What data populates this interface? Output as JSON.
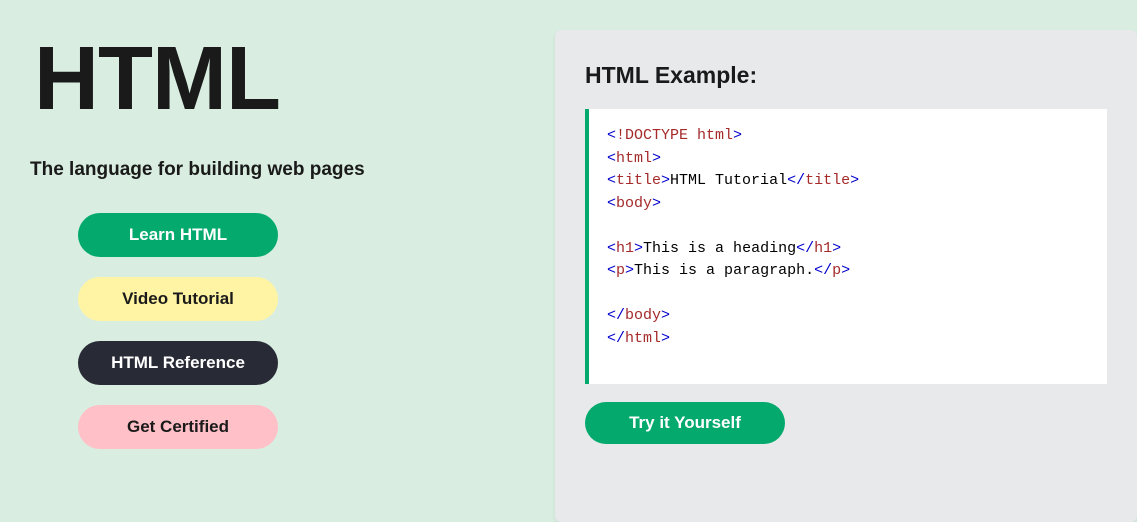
{
  "left": {
    "title": "HTML",
    "subtitle": "The language for building web pages",
    "buttons": {
      "learn": "Learn HTML",
      "video": "Video Tutorial",
      "reference": "HTML Reference",
      "certified": "Get Certified"
    }
  },
  "right": {
    "example_title": "HTML Example:",
    "try_label": "Try it Yourself",
    "code": {
      "line1_open": "<",
      "line1_tag": "!DOCTYPE",
      "line1_attr": " html",
      "line1_close": ">",
      "line2_open": "<",
      "line2_tag": "html",
      "line2_close": ">",
      "line3_open": "<",
      "line3_tag": "title",
      "line3_close": ">",
      "line3_text": "HTML Tutorial",
      "line3_end_open": "</",
      "line3_end_tag": "title",
      "line3_end_close": ">",
      "line4_open": "<",
      "line4_tag": "body",
      "line4_close": ">",
      "line5_open": "<",
      "line5_tag": "h1",
      "line5_close": ">",
      "line5_text": "This is a heading",
      "line5_end_open": "</",
      "line5_end_tag": "h1",
      "line5_end_close": ">",
      "line6_open": "<",
      "line6_tag": "p",
      "line6_close": ">",
      "line6_text": "This is a paragraph.",
      "line6_end_open": "</",
      "line6_end_tag": "p",
      "line6_end_close": ">",
      "line7_open": "</",
      "line7_tag": "body",
      "line7_close": ">",
      "line8_open": "</",
      "line8_tag": "html",
      "line8_close": ">"
    }
  }
}
